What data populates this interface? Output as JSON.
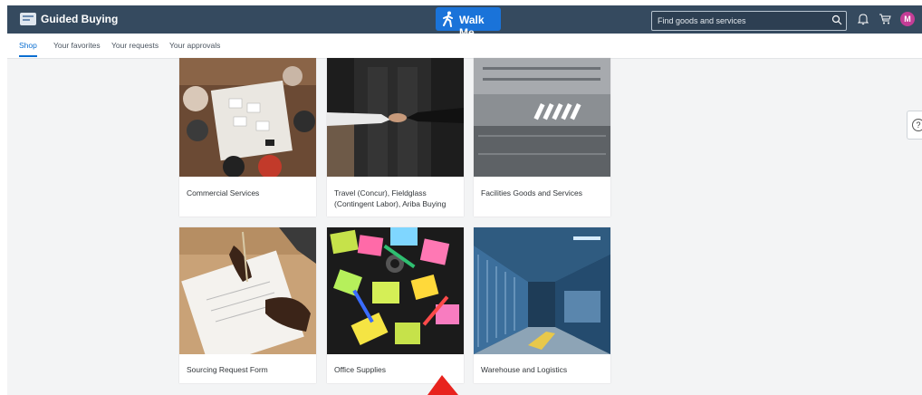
{
  "header": {
    "app_title": "Guided Buying",
    "walkme_label": "Walk Me",
    "search_placeholder": "Find goods and services",
    "avatar_initial": "M"
  },
  "tabs": [
    {
      "label": "Shop",
      "active": true
    },
    {
      "label": "Your favorites",
      "active": false
    },
    {
      "label": "Your requests",
      "active": false
    },
    {
      "label": "Your approvals",
      "active": false
    }
  ],
  "cards": [
    {
      "label": "Commercial Services",
      "image": "meeting-table-photo"
    },
    {
      "label": "Travel (Concur), Fieldglass (Contingent Labor), Ariba Buying",
      "image": "handshake-door-photo"
    },
    {
      "label": "Facilities Goods and Services",
      "image": "aerial-rooftop-photo"
    },
    {
      "label": "Sourcing Request Form",
      "image": "signing-document-photo"
    },
    {
      "label": "Office Supplies",
      "image": "sticky-notes-photo"
    },
    {
      "label": "Warehouse and Logistics",
      "image": "warehouse-interior-photo"
    }
  ],
  "help_label": "?",
  "colors": {
    "shell": "#354a5f",
    "accent": "#0a6ed1",
    "walkme": "#1a73d9",
    "avatar": "#c43d96"
  }
}
